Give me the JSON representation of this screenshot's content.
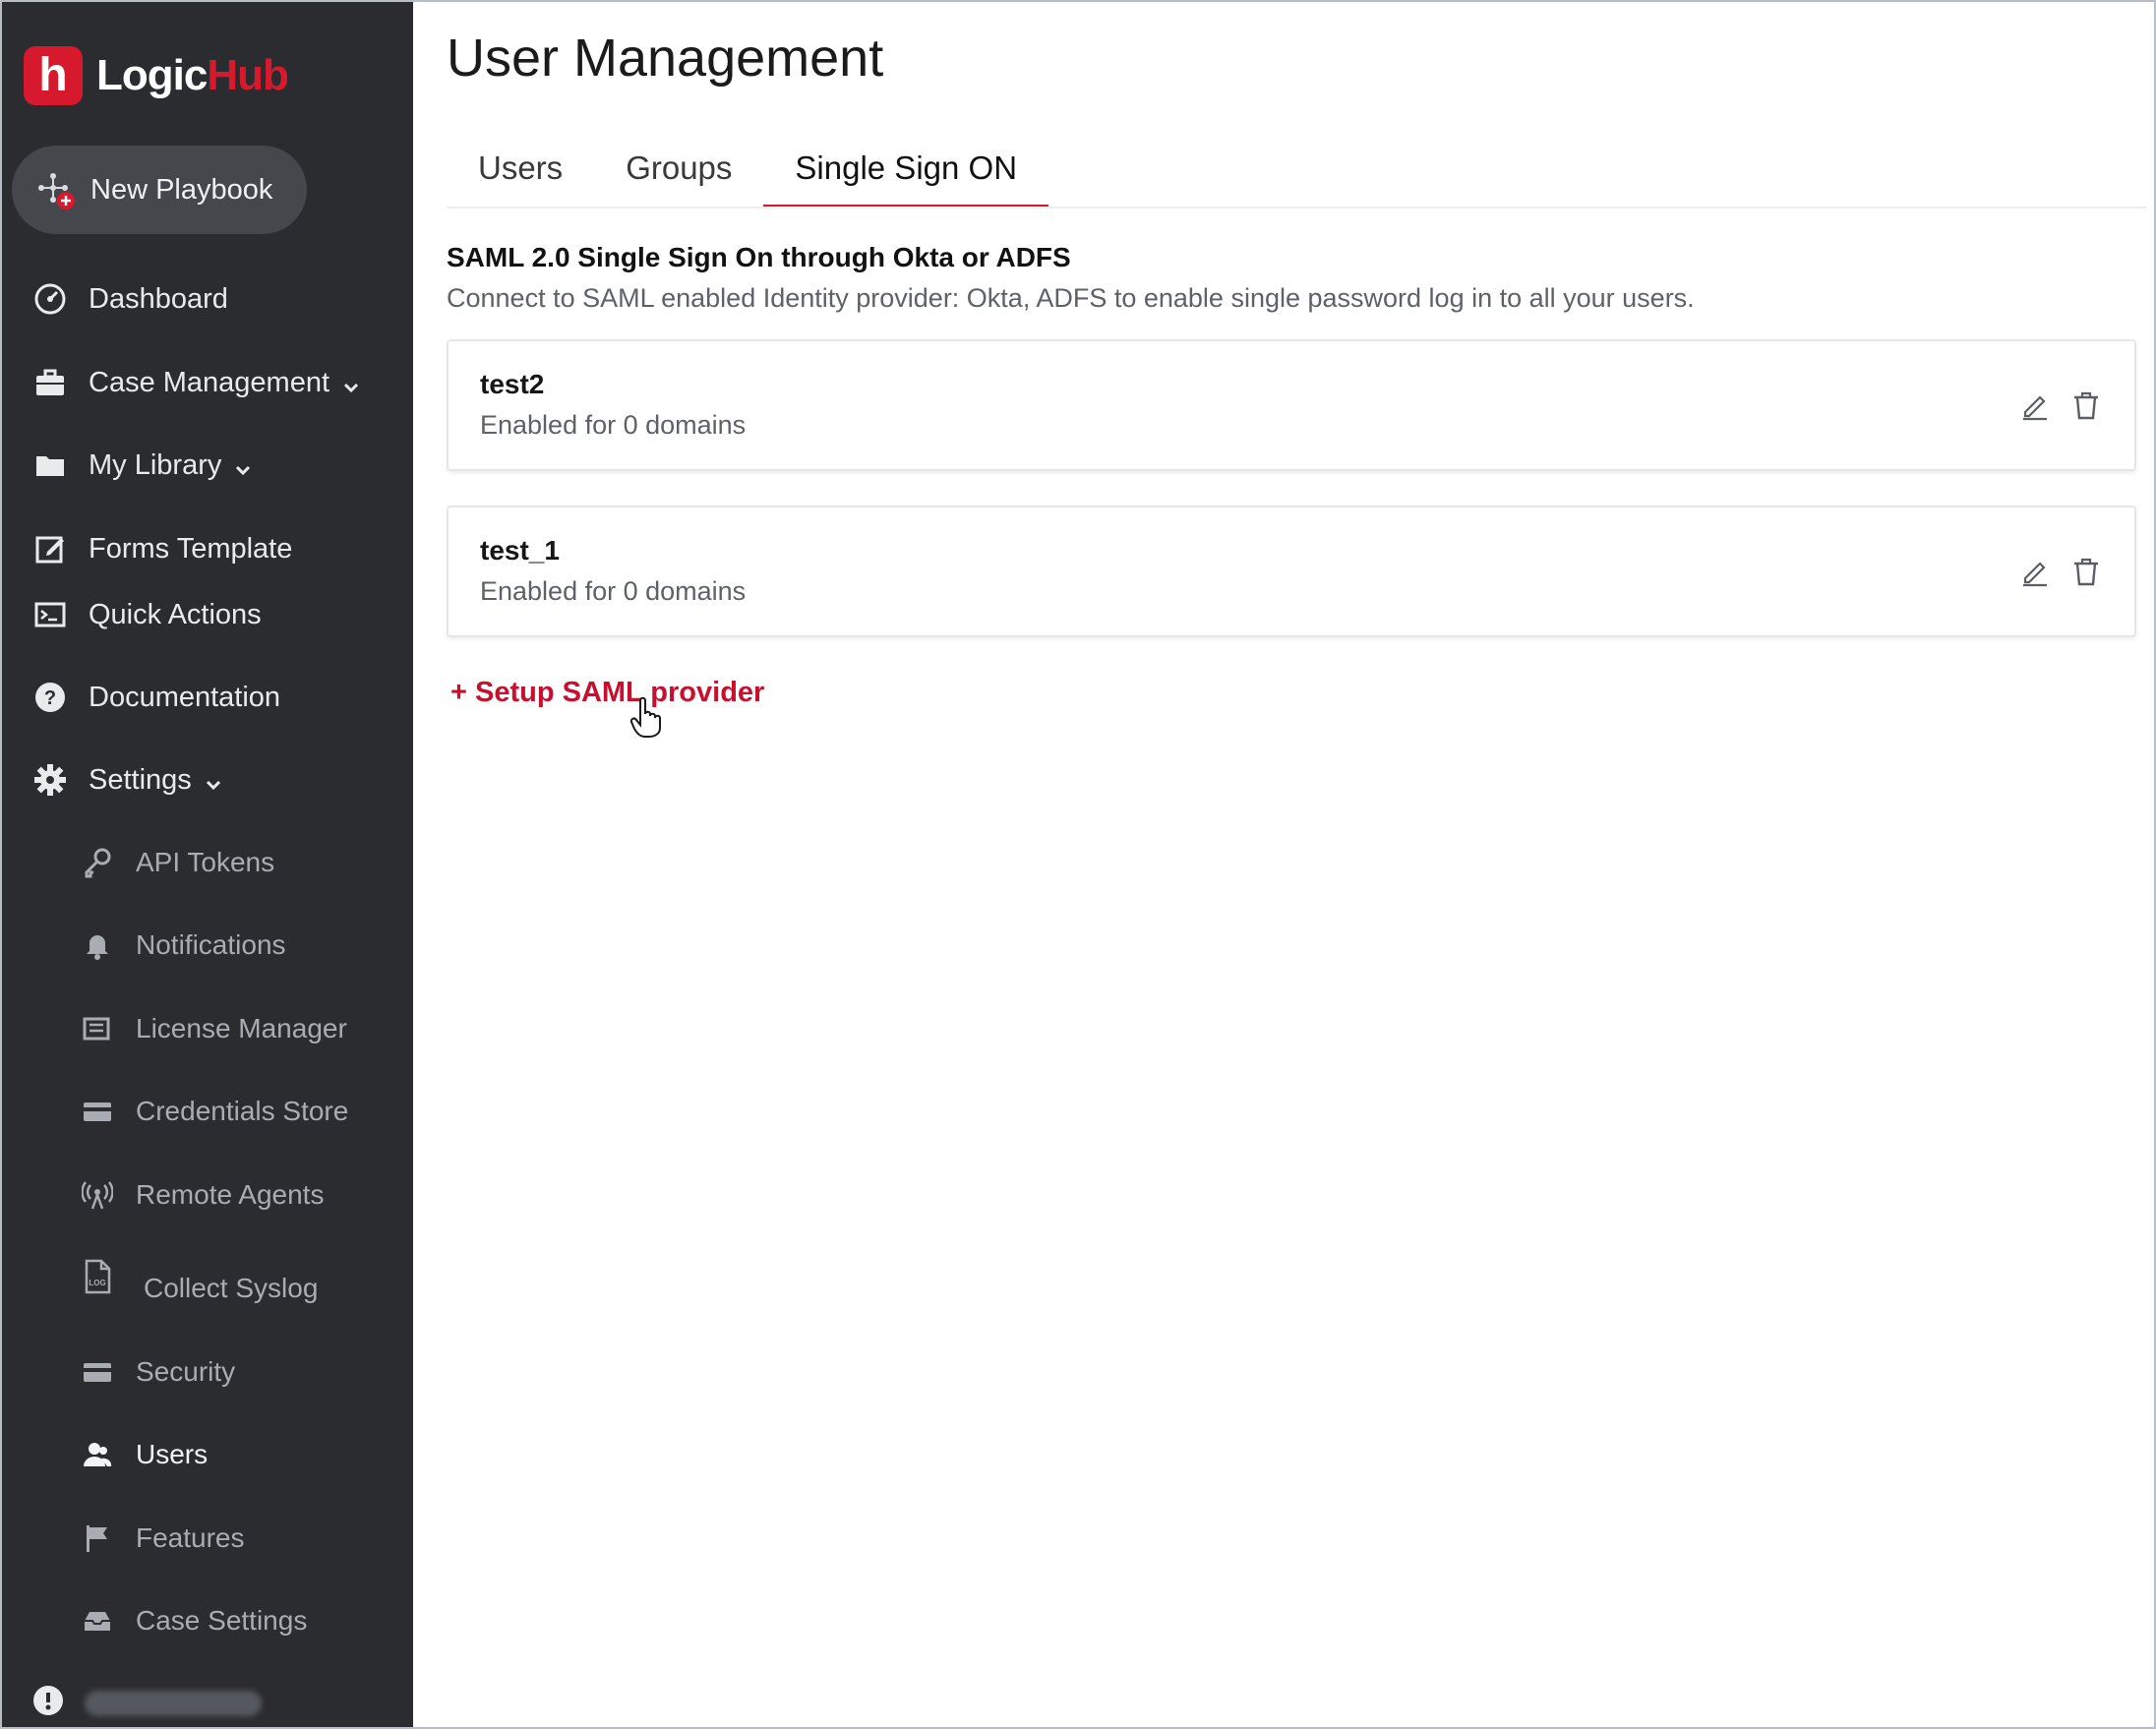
{
  "brand": {
    "logo_letter": "h",
    "name_part1": "Logic",
    "name_part2": "Hub"
  },
  "sidebar": {
    "new_playbook_label": "New Playbook",
    "items": [
      {
        "label": "Dashboard",
        "icon": "dashboard-icon"
      },
      {
        "label": "Case Management",
        "icon": "briefcase-icon",
        "has_chevron": true
      },
      {
        "label": "My Library",
        "icon": "folder-icon",
        "has_chevron": true
      },
      {
        "label": "Forms Template",
        "icon": "edit-form-icon"
      },
      {
        "label": "Quick Actions",
        "icon": "terminal-icon"
      },
      {
        "label": "Documentation",
        "icon": "help-icon"
      },
      {
        "label": "Settings",
        "icon": "gear-icon",
        "has_chevron": true
      }
    ],
    "settings_items": [
      {
        "label": "API Tokens",
        "icon": "key-icon"
      },
      {
        "label": "Notifications",
        "icon": "bell-icon"
      },
      {
        "label": "License Manager",
        "icon": "license-icon"
      },
      {
        "label": "Credentials Store",
        "icon": "credit-card-icon"
      },
      {
        "label": "Remote Agents",
        "icon": "antenna-icon"
      },
      {
        "label": "Collect Syslog",
        "icon": "log-file-icon"
      },
      {
        "label": "Security",
        "icon": "credit-card-icon"
      },
      {
        "label": "Users",
        "icon": "users-icon",
        "active": true
      },
      {
        "label": "Features",
        "icon": "flag-icon"
      },
      {
        "label": "Case Settings",
        "icon": "inbox-icon"
      }
    ]
  },
  "main": {
    "title": "User Management",
    "tabs": [
      {
        "label": "Users"
      },
      {
        "label": "Groups"
      },
      {
        "label": "Single Sign ON",
        "active": true
      }
    ],
    "section_title": "SAML 2.0 Single Sign On through Okta or ADFS",
    "section_desc": "Connect to SAML enabled Identity provider: Okta, ADFS to enable single password log in to all your users.",
    "providers": [
      {
        "name": "test2",
        "status": "Enabled for 0 domains"
      },
      {
        "name": "test_1",
        "status": "Enabled for 0 domains"
      }
    ],
    "setup_link": "+ Setup SAML provider"
  },
  "colors": {
    "accent": "#d7192e",
    "sidebar_bg": "#2b2c30",
    "link": "#c8102e"
  }
}
